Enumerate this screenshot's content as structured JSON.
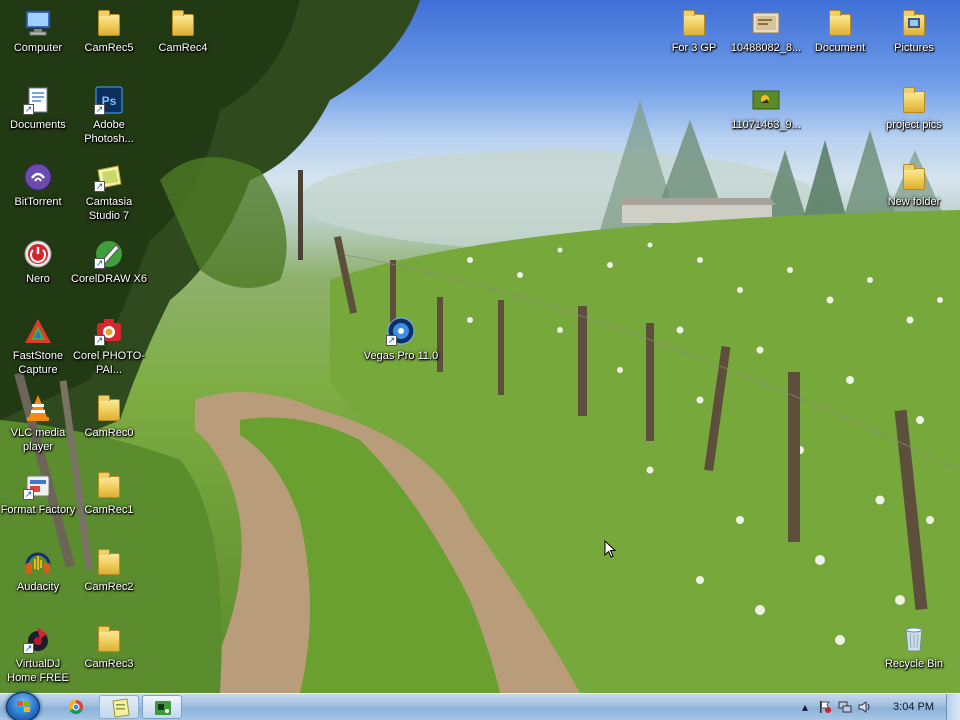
{
  "desktop": {
    "left_icons": [
      {
        "label": "Computer",
        "icon": "computer-icon"
      },
      {
        "label": "CamRec5",
        "icon": "folder-icon"
      },
      {
        "label": "CamRec4",
        "icon": "folder-icon"
      },
      {
        "label": "Documents",
        "icon": "documents-icon"
      },
      {
        "label": "Adobe Photosh...",
        "icon": "photoshop-icon"
      },
      {
        "label": "BitTorrent",
        "icon": "bittorrent-icon"
      },
      {
        "label": "Camtasia Studio 7",
        "icon": "camtasia-icon"
      },
      {
        "label": "Nero",
        "icon": "nero-icon"
      },
      {
        "label": "CorelDRAW X6",
        "icon": "coreldraw-icon"
      },
      {
        "label": "FastStone Capture",
        "icon": "faststone-icon"
      },
      {
        "label": "Corel PHOTO-PAI...",
        "icon": "corel-photopaint-icon"
      },
      {
        "label": "VLC media player",
        "icon": "vlc-icon"
      },
      {
        "label": "CamRec0",
        "icon": "folder-icon"
      },
      {
        "label": "Format Factory",
        "icon": "format-factory-icon"
      },
      {
        "label": "CamRec1",
        "icon": "folder-icon"
      },
      {
        "label": "Audacity",
        "icon": "audacity-icon"
      },
      {
        "label": "CamRec2",
        "icon": "folder-icon"
      },
      {
        "label": "VirtualDJ Home FREE",
        "icon": "virtualdj-icon"
      },
      {
        "label": "CamRec3",
        "icon": "folder-icon"
      },
      {
        "label": "Vegas Pro 11.0",
        "icon": "vegas-icon"
      }
    ],
    "right_icons": [
      {
        "label": "For 3 GP",
        "icon": "folder-icon"
      },
      {
        "label": "10488082_8...",
        "icon": "image-file-icon"
      },
      {
        "label": "Document",
        "icon": "folder-icon"
      },
      {
        "label": "Pictures",
        "icon": "pictures-folder-icon"
      },
      {
        "label": "11071463_9...",
        "icon": "image-file-icon"
      },
      {
        "label": "project pics",
        "icon": "folder-icon"
      },
      {
        "label": "New folder",
        "icon": "folder-icon"
      },
      {
        "label": "Recycle Bin",
        "icon": "recycle-bin-icon"
      }
    ]
  },
  "taskbar": {
    "pinned": [
      {
        "icon": "chrome-icon"
      },
      {
        "icon": "notepad-icon"
      },
      {
        "icon": "camrecorder-icon"
      }
    ],
    "tray": {
      "icons": [
        "chevron-up-icon",
        "action-center-flag-icon",
        "network-icon",
        "volume-icon"
      ],
      "clock": "3:04 PM"
    },
    "colors": {
      "bar": "#a9c6e6",
      "start_orb": "#2a74c9"
    }
  }
}
